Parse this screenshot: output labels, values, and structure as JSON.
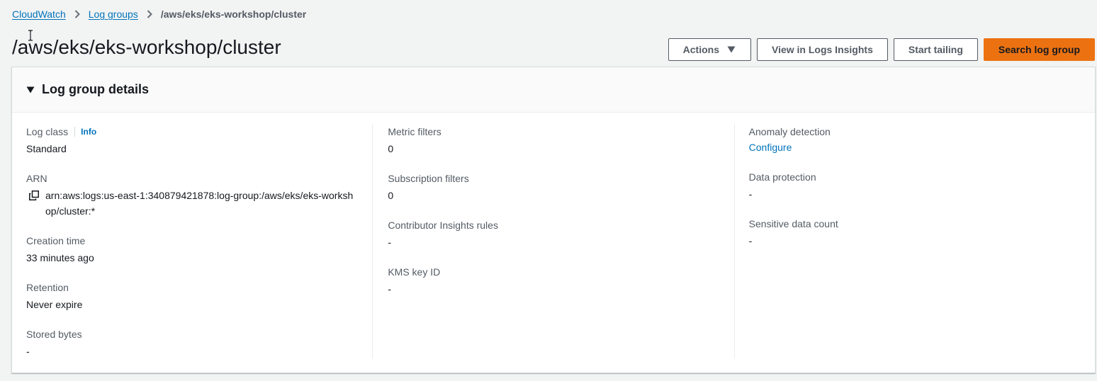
{
  "breadcrumb": {
    "items": [
      {
        "label": "CloudWatch"
      },
      {
        "label": "Log groups"
      }
    ],
    "current": "/aws/eks/eks-workshop/cluster"
  },
  "page": {
    "title": "/aws/eks/eks-workshop/cluster"
  },
  "actions": {
    "actions_label": "Actions",
    "insights_label": "View in Logs Insights",
    "tailing_label": "Start tailing",
    "search_label": "Search log group"
  },
  "panel": {
    "title": "Log group details",
    "col1": {
      "log_class_label": "Log class",
      "info_label": "Info",
      "log_class_value": "Standard",
      "arn_label": "ARN",
      "arn_value": "arn:aws:logs:us-east-1:340879421878:log-group:/aws/eks/eks-workshop/cluster:*",
      "creation_label": "Creation time",
      "creation_value": "33 minutes ago",
      "retention_label": "Retention",
      "retention_value": "Never expire",
      "stored_label": "Stored bytes",
      "stored_value": "-"
    },
    "col2": {
      "metric_label": "Metric filters",
      "metric_value": "0",
      "subscription_label": "Subscription filters",
      "subscription_value": "0",
      "contributor_label": "Contributor Insights rules",
      "contributor_value": "-",
      "kms_label": "KMS key ID",
      "kms_value": "-"
    },
    "col3": {
      "anomaly_label": "Anomaly detection",
      "anomaly_value": "Configure",
      "protection_label": "Data protection",
      "protection_value": "-",
      "sensitive_label": "Sensitive data count",
      "sensitive_value": "-"
    }
  },
  "colors": {
    "link": "#0073bb",
    "primary": "#ec7211",
    "background": "#f2f3f3"
  },
  "icons": {
    "breadcrumb_separator": "chevron-right-icon",
    "actions_caret": "caret-down-icon",
    "expand": "triangle-down-icon",
    "copy": "copy-icon",
    "cursor": "text-cursor-icon"
  }
}
